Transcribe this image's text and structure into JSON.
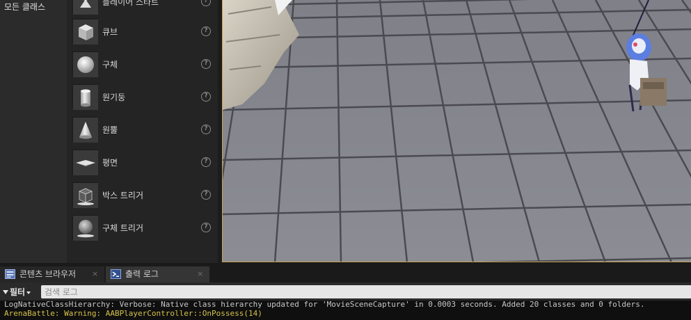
{
  "category": {
    "label": "모든 클래스"
  },
  "place_items": [
    {
      "label": "플레이어 스타트",
      "thumb": "player-start-icon"
    },
    {
      "label": "큐브",
      "thumb": "cube-icon"
    },
    {
      "label": "구체",
      "thumb": "sphere-icon"
    },
    {
      "label": "원기둥",
      "thumb": "cylinder-icon"
    },
    {
      "label": "원뿔",
      "thumb": "cone-icon"
    },
    {
      "label": "평면",
      "thumb": "plane-icon"
    },
    {
      "label": "박스 트리거",
      "thumb": "box-trigger-icon"
    },
    {
      "label": "구체 트리거",
      "thumb": "sphere-trigger-icon"
    }
  ],
  "help_glyph": "?",
  "tabs": [
    {
      "label": "콘텐츠 브라우저",
      "icon": "content-browser-icon",
      "close": "×"
    },
    {
      "label": "출력 로그",
      "icon": "output-log-icon",
      "close": "×"
    }
  ],
  "filter": {
    "label": "필터",
    "search_placeholder": "검색 로그"
  },
  "log_lines": [
    "LogNativeClassHierarchy: Verbose: Native class hierarchy updated for 'MovieSceneCapture' in 0.0003 seconds. Added 20 classes and 0 folders.",
    "ArenaBattle: Warning: AABPlayerController::OnPossess(14)"
  ],
  "colors": {
    "viewport_border": "#c9a253",
    "warning_text": "#d6c24a",
    "log_text": "#c8c8c8"
  }
}
